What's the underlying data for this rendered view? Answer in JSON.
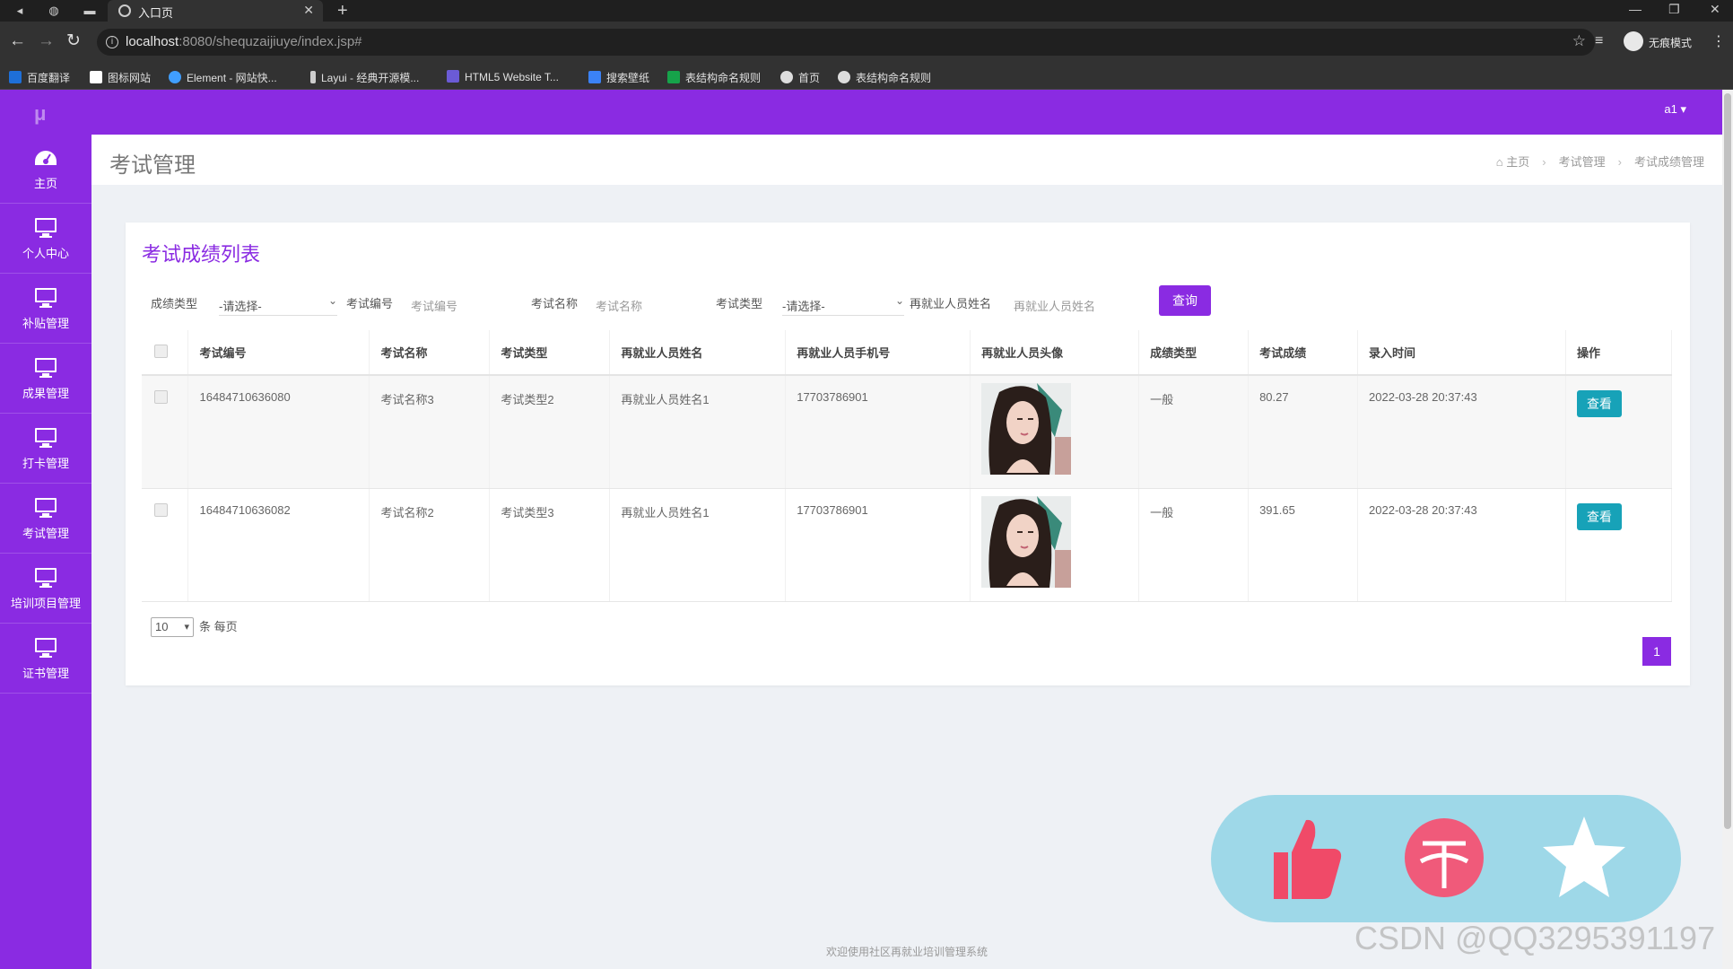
{
  "browser": {
    "tab_title": "入口页",
    "url_host": "localhost",
    "url_rest": ":8080/shequzaijiuye/index.jsp#",
    "profile_label": "无痕模式",
    "bookmarks": [
      {
        "label": "百度翻译",
        "color": "#1e6fd9"
      },
      {
        "label": "图标网站",
        "color": "#ffffff"
      },
      {
        "label": "Element - 网站快...",
        "color": "#409eff"
      },
      {
        "label": "Layui - 经典开源模...",
        "color": "#cccccc"
      },
      {
        "label": "HTML5 Website T...",
        "color": "#6b5bd6"
      },
      {
        "label": "搜索壁纸",
        "color": "#3b82f6"
      },
      {
        "label": "表结构命名规则",
        "color": "#16a34a"
      },
      {
        "label": "首页",
        "color": "#dddddd"
      },
      {
        "label": "表结构命名规则",
        "color": "#dddddd"
      }
    ]
  },
  "app": {
    "accent": "#8a2be2",
    "logo": "μ",
    "user_menu": "a1 ▾",
    "sidebar": [
      {
        "label": "主页",
        "icon": "dashboard-icon"
      },
      {
        "label": "个人中心",
        "icon": "monitor-icon"
      },
      {
        "label": "补贴管理",
        "icon": "monitor-icon"
      },
      {
        "label": "成果管理",
        "icon": "monitor-icon"
      },
      {
        "label": "打卡管理",
        "icon": "monitor-icon"
      },
      {
        "label": "考试管理",
        "icon": "monitor-icon"
      },
      {
        "label": "培训项目管理",
        "icon": "monitor-icon"
      },
      {
        "label": "证书管理",
        "icon": "monitor-icon"
      }
    ],
    "page_title": "考试管理",
    "breadcrumb": [
      "主页",
      "考试管理",
      "考试成绩管理"
    ],
    "card_title": "考试成绩列表",
    "filters": {
      "score_type_label": "成绩类型",
      "score_type_value": "-请选择-",
      "exam_no_label": "考试编号",
      "exam_no_placeholder": "考试编号",
      "exam_name_label": "考试名称",
      "exam_name_placeholder": "考试名称",
      "exam_type_label": "考试类型",
      "exam_type_value": "-请选择-",
      "person_name_label": "再就业人员姓名",
      "person_name_placeholder": "再就业人员姓名",
      "query_button": "查询"
    },
    "table": {
      "headers": [
        "考试编号",
        "考试名称",
        "考试类型",
        "再就业人员姓名",
        "再就业人员手机号",
        "再就业人员头像",
        "成绩类型",
        "考试成绩",
        "录入时间",
        "操作"
      ],
      "rows": [
        {
          "exam_no": "16484710636080",
          "exam_name": "考试名称3",
          "exam_type": "考试类型2",
          "person_name": "再就业人员姓名1",
          "phone": "17703786901",
          "score_type": "一般",
          "score": "80.27",
          "time": "2022-03-28 20:37:43",
          "action": "查看"
        },
        {
          "exam_no": "16484710636082",
          "exam_name": "考试名称2",
          "exam_type": "考试类型3",
          "person_name": "再就业人员姓名1",
          "phone": "17703786901",
          "score_type": "一般",
          "score": "391.65",
          "time": "2022-03-28 20:37:43",
          "action": "查看"
        }
      ]
    },
    "page_size_value": "10",
    "page_size_suffix": "条 每页",
    "current_page": "1",
    "footer": "欢迎使用社区再就业培训管理系统"
  },
  "watermark": "CSDN @QQ3295391197"
}
